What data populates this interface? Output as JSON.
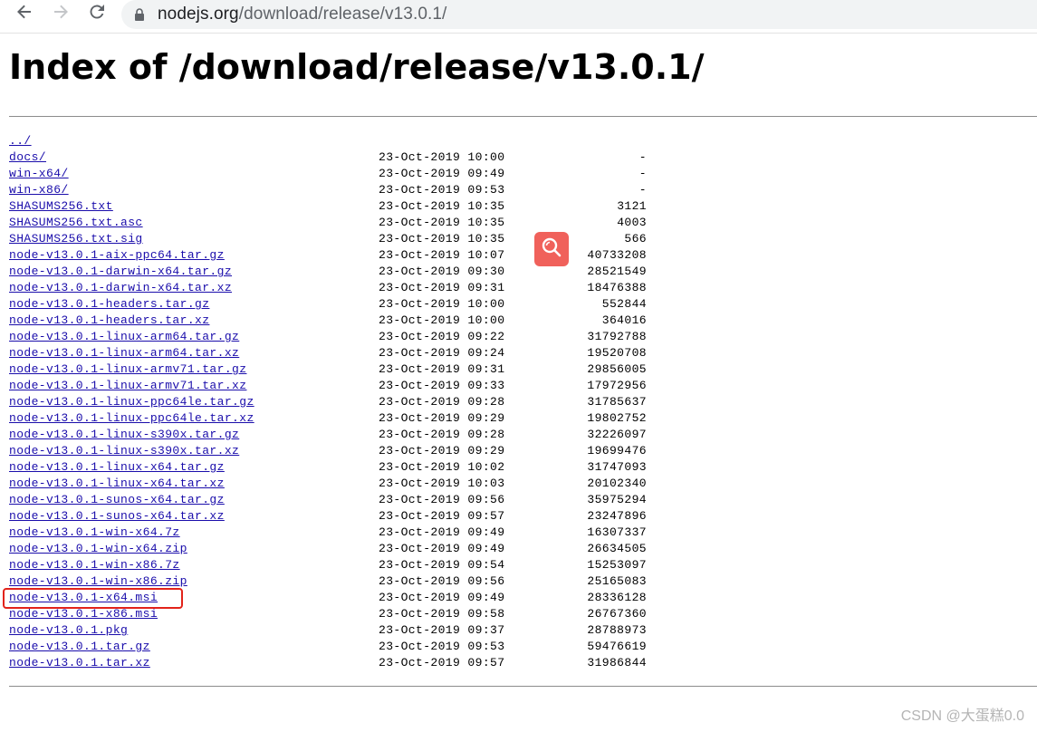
{
  "browser": {
    "url_host": "nodejs.org",
    "url_path": "/download/release/v13.0.1/"
  },
  "page": {
    "title": "Index of /download/release/v13.0.1/"
  },
  "listing": [
    {
      "name": "../",
      "date": "",
      "size": ""
    },
    {
      "name": "docs/",
      "date": "23-Oct-2019 10:00",
      "size": "-"
    },
    {
      "name": "win-x64/",
      "date": "23-Oct-2019 09:49",
      "size": "-"
    },
    {
      "name": "win-x86/",
      "date": "23-Oct-2019 09:53",
      "size": "-"
    },
    {
      "name": "SHASUMS256.txt",
      "date": "23-Oct-2019 10:35",
      "size": "3121"
    },
    {
      "name": "SHASUMS256.txt.asc",
      "date": "23-Oct-2019 10:35",
      "size": "4003"
    },
    {
      "name": "SHASUMS256.txt.sig",
      "date": "23-Oct-2019 10:35",
      "size": "566"
    },
    {
      "name": "node-v13.0.1-aix-ppc64.tar.gz",
      "date": "23-Oct-2019 10:07",
      "size": "40733208"
    },
    {
      "name": "node-v13.0.1-darwin-x64.tar.gz",
      "date": "23-Oct-2019 09:30",
      "size": "28521549"
    },
    {
      "name": "node-v13.0.1-darwin-x64.tar.xz",
      "date": "23-Oct-2019 09:31",
      "size": "18476388"
    },
    {
      "name": "node-v13.0.1-headers.tar.gz",
      "date": "23-Oct-2019 10:00",
      "size": "552844"
    },
    {
      "name": "node-v13.0.1-headers.tar.xz",
      "date": "23-Oct-2019 10:00",
      "size": "364016"
    },
    {
      "name": "node-v13.0.1-linux-arm64.tar.gz",
      "date": "23-Oct-2019 09:22",
      "size": "31792788"
    },
    {
      "name": "node-v13.0.1-linux-arm64.tar.xz",
      "date": "23-Oct-2019 09:24",
      "size": "19520708"
    },
    {
      "name": "node-v13.0.1-linux-armv71.tar.gz",
      "date": "23-Oct-2019 09:31",
      "size": "29856005"
    },
    {
      "name": "node-v13.0.1-linux-armv71.tar.xz",
      "date": "23-Oct-2019 09:33",
      "size": "17972956"
    },
    {
      "name": "node-v13.0.1-linux-ppc64le.tar.gz",
      "date": "23-Oct-2019 09:28",
      "size": "31785637"
    },
    {
      "name": "node-v13.0.1-linux-ppc64le.tar.xz",
      "date": "23-Oct-2019 09:29",
      "size": "19802752"
    },
    {
      "name": "node-v13.0.1-linux-s390x.tar.gz",
      "date": "23-Oct-2019 09:28",
      "size": "32226097"
    },
    {
      "name": "node-v13.0.1-linux-s390x.tar.xz",
      "date": "23-Oct-2019 09:29",
      "size": "19699476"
    },
    {
      "name": "node-v13.0.1-linux-x64.tar.gz",
      "date": "23-Oct-2019 10:02",
      "size": "31747093"
    },
    {
      "name": "node-v13.0.1-linux-x64.tar.xz",
      "date": "23-Oct-2019 10:03",
      "size": "20102340"
    },
    {
      "name": "node-v13.0.1-sunos-x64.tar.gz",
      "date": "23-Oct-2019 09:56",
      "size": "35975294"
    },
    {
      "name": "node-v13.0.1-sunos-x64.tar.xz",
      "date": "23-Oct-2019 09:57",
      "size": "23247896"
    },
    {
      "name": "node-v13.0.1-win-x64.7z",
      "date": "23-Oct-2019 09:49",
      "size": "16307337"
    },
    {
      "name": "node-v13.0.1-win-x64.zip",
      "date": "23-Oct-2019 09:49",
      "size": "26634505"
    },
    {
      "name": "node-v13.0.1-win-x86.7z",
      "date": "23-Oct-2019 09:54",
      "size": "15253097"
    },
    {
      "name": "node-v13.0.1-win-x86.zip",
      "date": "23-Oct-2019 09:56",
      "size": "25165083"
    },
    {
      "name": "node-v13.0.1-x64.msi",
      "date": "23-Oct-2019 09:49",
      "size": "28336128"
    },
    {
      "name": "node-v13.0.1-x86.msi",
      "date": "23-Oct-2019 09:58",
      "size": "26767360"
    },
    {
      "name": "node-v13.0.1.pkg",
      "date": "23-Oct-2019 09:37",
      "size": "28788973"
    },
    {
      "name": "node-v13.0.1.tar.gz",
      "date": "23-Oct-2019 09:53",
      "size": "59476619"
    },
    {
      "name": "node-v13.0.1.tar.xz",
      "date": "23-Oct-2019 09:57",
      "size": "31986844"
    }
  ],
  "watermark": "CSDN @大蛋糕0.0",
  "icons": {
    "back": "back-arrow-icon",
    "forward": "forward-arrow-icon",
    "reload": "reload-icon",
    "lock": "lock-icon",
    "search_fab": "search-icon"
  },
  "colors": {
    "link": "#1a0dab",
    "highlight": "#e2231a",
    "search_fab": "#f0615b"
  }
}
